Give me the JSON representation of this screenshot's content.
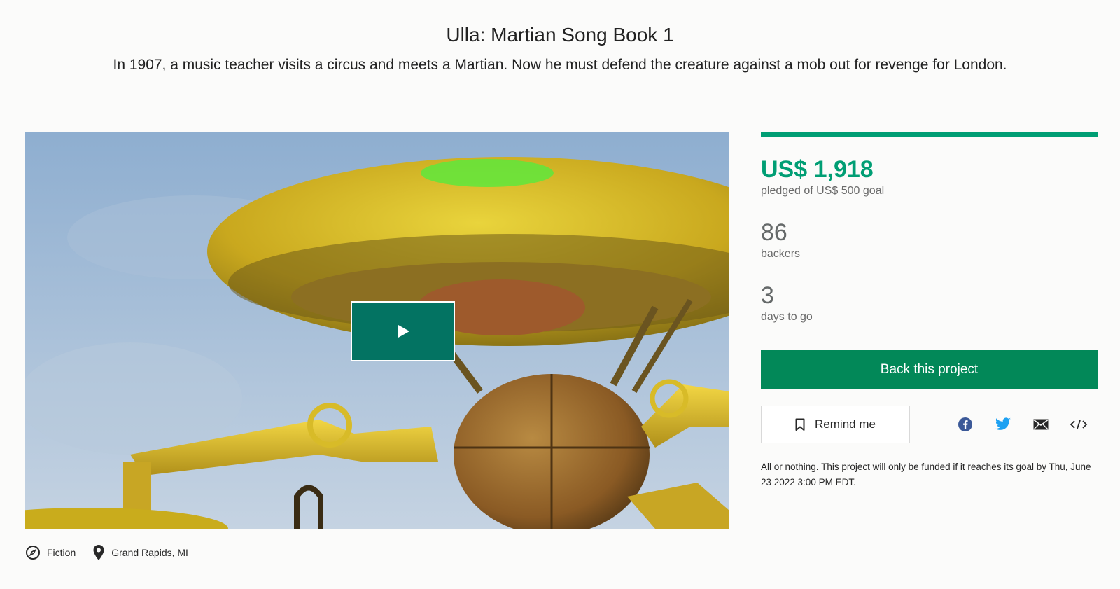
{
  "project": {
    "title": "Ulla: Martian Song Book 1",
    "blurb": "In 1907, a music teacher visits a circus and meets a Martian. Now he must defend the creature against a mob out for revenge for London."
  },
  "meta": {
    "category": "Fiction",
    "category_icon": "compass-icon",
    "location": "Grand Rapids, MI",
    "location_icon": "map-pin-icon"
  },
  "funding": {
    "progress_fraction": 1.0,
    "pledged": "US$ 1,918",
    "pledged_label": "pledged of US$ 500 goal",
    "backers": "86",
    "backers_label": "backers",
    "days": "3",
    "days_label": "days to go"
  },
  "actions": {
    "back_label": "Back this project",
    "remind_label": "Remind me",
    "share_icons": [
      "facebook-icon",
      "twitter-icon",
      "email-icon",
      "embed-icon"
    ]
  },
  "fine_print": {
    "link": "All or nothing.",
    "text": " This project will only be funded if it reaches its goal by Thu, June 23 2022 3:00 PM EDT."
  },
  "colors": {
    "accent_green": "#009e74",
    "button_green": "#028858",
    "play_button": "#037362"
  }
}
